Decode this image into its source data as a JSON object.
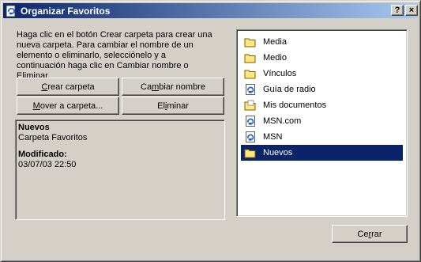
{
  "window": {
    "title": "Organizar Favoritos",
    "help_button": "?",
    "close_button": "×"
  },
  "instructions": "Haga clic en el botón Crear carpeta para crear una nueva carpeta. Para cambiar el nombre de un elemento o eliminarlo, selecciónelo y a continuación haga clic en Cambiar nombre o Eliminar.",
  "buttons": {
    "crear_carpeta": {
      "accel": "C",
      "rest": "rear carpeta"
    },
    "cambiar_nombre": {
      "pre": "Ca",
      "accel": "m",
      "rest": "biar nombre"
    },
    "mover_a_carpeta": {
      "accel": "M",
      "rest": "over a carpeta..."
    },
    "eliminar": {
      "pre": "El",
      "accel": "i",
      "rest": "minar"
    },
    "cerrar": {
      "pre": "Ce",
      "accel": "r",
      "rest": "rar"
    }
  },
  "info": {
    "name": "Nuevos",
    "type": "Carpeta Favoritos",
    "modified_label": "Modificado:",
    "modified_value": "03/07/03 22:50"
  },
  "favorites": [
    {
      "label": "Media",
      "icon": "folder-icon"
    },
    {
      "label": "Medio",
      "icon": "folder-icon"
    },
    {
      "label": "Vínculos",
      "icon": "folder-icon"
    },
    {
      "label": "Guía de radio",
      "icon": "ie-page-icon"
    },
    {
      "label": "Mis documentos",
      "icon": "my-documents-folder-icon"
    },
    {
      "label": "MSN.com",
      "icon": "ie-page-icon"
    },
    {
      "label": "MSN",
      "icon": "ie-page-icon"
    },
    {
      "label": "Nuevos",
      "icon": "folder-icon",
      "selected": true
    }
  ],
  "colors": {
    "title_gradient_start": "#0a246a",
    "title_gradient_end": "#a6caf0",
    "dialog_face": "#d4d0c8",
    "selection": "#0a246a"
  }
}
